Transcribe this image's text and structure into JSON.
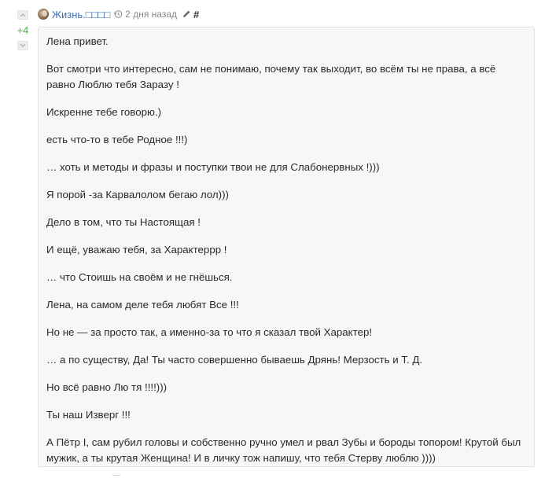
{
  "vote": {
    "score": "+4"
  },
  "comment": {
    "author": "Жизнь.□□□□",
    "time": "2 дня назад",
    "hash": "#",
    "paragraphs": [
      "Лена привет.",
      "Вот смотри что интересно, сам не понимаю, почему так выходит, во всём ты не права, а всё равно Люблю тебя Заразу !",
      "Искренне тебе говорю.)",
      "есть что-то в тебе Родное !!!)",
      "… хоть и методы и фразы и поступки твои не для Слабонервных !)))",
      "Я порой -за Карвалолом бегаю лол)))",
      "Дело в том, что ты Настоящая !",
      "И ещё, уважаю тебя, за Характерpp !",
      "… что Стоишь на своём и не гнёшься.",
      "Лена, на самом деле тебя любят Все !!!",
      "Но не — за просто так, а именно-за то что я сказал твой Характер!",
      "… а по существу, Да! Ты часто совершенно бываешь Дрянь! Мерзость и Т. Д.",
      "Но всё равно Лю тя !!!!)))",
      "Ты наш Изверг !!!",
      "А Пётр I, сам рубил головы и собственно ручно умел и рвал Зубы и бороды топором! Крутой был мужик, а ты крутая Женщина! И в личку тож напишу, что тебя Стерву люблю ))))"
    ]
  },
  "icons": {
    "vote_up": "chevron-up-icon",
    "vote_down": "chevron-down-icon",
    "avatar": "avatar-image",
    "history": "history-icon",
    "edit": "pencil-icon"
  },
  "colors": {
    "score": "#4caf50",
    "username": "#3b73b9",
    "comment_bg": "#f7f7f7",
    "comment_border": "#e4e4e4"
  }
}
